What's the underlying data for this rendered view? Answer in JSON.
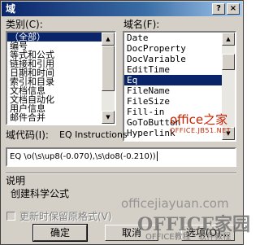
{
  "window": {
    "title": "域",
    "help_glyph": "?",
    "close_glyph": "×"
  },
  "categories": {
    "label": "类别(C):",
    "items": [
      "（全部）",
      "编号",
      "等式和公式",
      "链接和引用",
      "日期和时间",
      "索引和目录",
      "文档信息",
      "文档自动化",
      "用户信息",
      "邮件合并"
    ],
    "selected_index": 0
  },
  "fields": {
    "label": "域名(F):",
    "items": [
      "Date",
      "DocProperty",
      "DocVariable",
      "EditTime",
      "Eq",
      "FileName",
      "FileSize",
      "Fill-in",
      "GoToButton",
      "Hyperlink"
    ],
    "selected_index": 4
  },
  "field_code": {
    "label": "域代码(I):",
    "hint": "EQ Instructions",
    "value": "EQ \\o(\\s\\up8(-0.070),\\s\\do8(-0.210))"
  },
  "description": {
    "label": "说明",
    "text": "创建科学公式"
  },
  "preserve_format": {
    "label": "更新时保留原格式(V)",
    "checked": false,
    "enabled": false
  },
  "buttons": {
    "ok": "确定",
    "cancel": "取消",
    "options": "选项(O)..."
  },
  "watermarks": {
    "office_cn": "office之家",
    "office_url": "OFFICE.JB51.NET",
    "site": "officejiayuan.com",
    "brand": "OFFICE家园",
    "tagline": "OFFICE教程 · 软件教程"
  },
  "colors": {
    "selection": "#0a246a",
    "dialog_bg": "#d4d0c8",
    "title_start": "#0a246a",
    "watermark_red": "#cc2200"
  }
}
